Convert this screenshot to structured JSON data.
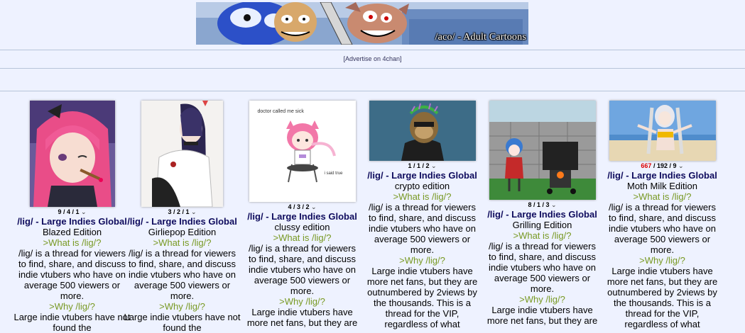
{
  "banner": {
    "caption": "/aco/ - Adult Cartoons",
    "colors": {
      "sky": "#8aa6cf",
      "blue": "#2c50c8",
      "skin": "#d8a86b",
      "ear": "#c98a70"
    }
  },
  "ad": {
    "text": "[Advertise on 4chan]"
  },
  "threads": [
    {
      "stats": "9 / 4 / 1",
      "stats_parts": {
        "replies": "9",
        "images": "4",
        "page": "1",
        "replies_red": false
      },
      "board": "/lig/",
      "title": "Large Indies Global",
      "edition": "Blazed Edition",
      "lines": [
        {
          "text": ">What is /lig/?",
          "style": "green"
        },
        {
          "text": "/lig/ is a thread for viewers to find, share, and discuss indie vtubers who have on average 500 viewers or more.",
          "style": "plain"
        },
        {
          "text": ">Why /lig/?",
          "style": "green"
        },
        {
          "text": "Large indie vtubers have not found the",
          "style": "plain"
        }
      ]
    },
    {
      "stats": "3 / 2 / 1",
      "stats_parts": {
        "replies": "3",
        "images": "2",
        "page": "1",
        "replies_red": false
      },
      "board": "/lig/",
      "title": "Large Indies Global",
      "edition": "Girliepop Edition",
      "lines": [
        {
          "text": ">What is /lig/?",
          "style": "green"
        },
        {
          "text": "/lig/ is a thread for viewers to find, share, and discuss indie vtubers who have on average 500 viewers or more.",
          "style": "plain"
        },
        {
          "text": ">Why /lig/?",
          "style": "green"
        },
        {
          "text": "Large indie vtubers have not found the",
          "style": "plain"
        }
      ]
    },
    {
      "stats": "4 / 3 / 2",
      "stats_parts": {
        "replies": "4",
        "images": "3",
        "page": "2",
        "replies_red": false
      },
      "board": "/lig/",
      "title": "Large Indies Global",
      "edition": "clussy edition",
      "thumb_text": {
        "top": "doctor called me sick",
        "bottom": "i said true"
      },
      "lines": [
        {
          "text": ">What is /lig/?",
          "style": "green"
        },
        {
          "text": "/lig/ is a thread for viewers to find, share, and discuss indie vtubers who have on average 500 viewers or more.",
          "style": "plain"
        },
        {
          "text": ">Why /lig/?",
          "style": "green"
        },
        {
          "text": "Large indie vtubers have more net fans, but they are",
          "style": "plain"
        }
      ]
    },
    {
      "stats": "1 / 1 / 2",
      "stats_parts": {
        "replies": "1",
        "images": "1",
        "page": "2",
        "replies_red": false
      },
      "board": "/lig/",
      "title": "Large Indies Global",
      "edition": "crypto edition",
      "lines": [
        {
          "text": ">What is /lig/?",
          "style": "green"
        },
        {
          "text": "/lig/ is a thread for viewers to find, share, and discuss indie vtubers who have on average 500 viewers or more.",
          "style": "plain"
        },
        {
          "text": ">Why /lig/?",
          "style": "green"
        },
        {
          "text": "Large indie vtubers have more net fans, but they are outnumbered by 2views by the thousands. This is a thread for the VIP, regardless of what",
          "style": "plain"
        }
      ]
    },
    {
      "stats": "8 / 1 / 3",
      "stats_parts": {
        "replies": "8",
        "images": "1",
        "page": "3",
        "replies_red": false
      },
      "board": "/lig/",
      "title": "Large Indies Global",
      "edition": "Grilling Edition",
      "lines": [
        {
          "text": ">What is /lig/?",
          "style": "green"
        },
        {
          "text": "/lig/ is a thread for viewers to find, share, and discuss indie vtubers who have on average 500 viewers or more.",
          "style": "plain"
        },
        {
          "text": ">Why /lig/?",
          "style": "green"
        },
        {
          "text": "Large indie vtubers have more net fans, but they are",
          "style": "plain"
        }
      ]
    },
    {
      "stats": "667 / 192 / 9",
      "stats_parts": {
        "replies": "667",
        "images": "192",
        "page": "9",
        "replies_red": true
      },
      "board": "/lig/",
      "title": "Large Indies Global",
      "edition": "Moth Milk Edition",
      "lines": [
        {
          "text": ">What is /lig/?",
          "style": "green"
        },
        {
          "text": "/lig/ is a thread for viewers to find, share, and discuss indie vtubers who have on average 500 viewers or more.",
          "style": "plain"
        },
        {
          "text": ">Why /lig/?",
          "style": "green"
        },
        {
          "text": "Large indie vtubers have more net fans, but they are outnumbered by 2views by the thousands. This is a thread for the VIP, regardless of what",
          "style": "plain"
        }
      ]
    }
  ],
  "colors": {
    "background": "#eef2ff",
    "title": "#0f0c5d",
    "greentext": "#789922",
    "reply_hot": "#d00000"
  }
}
